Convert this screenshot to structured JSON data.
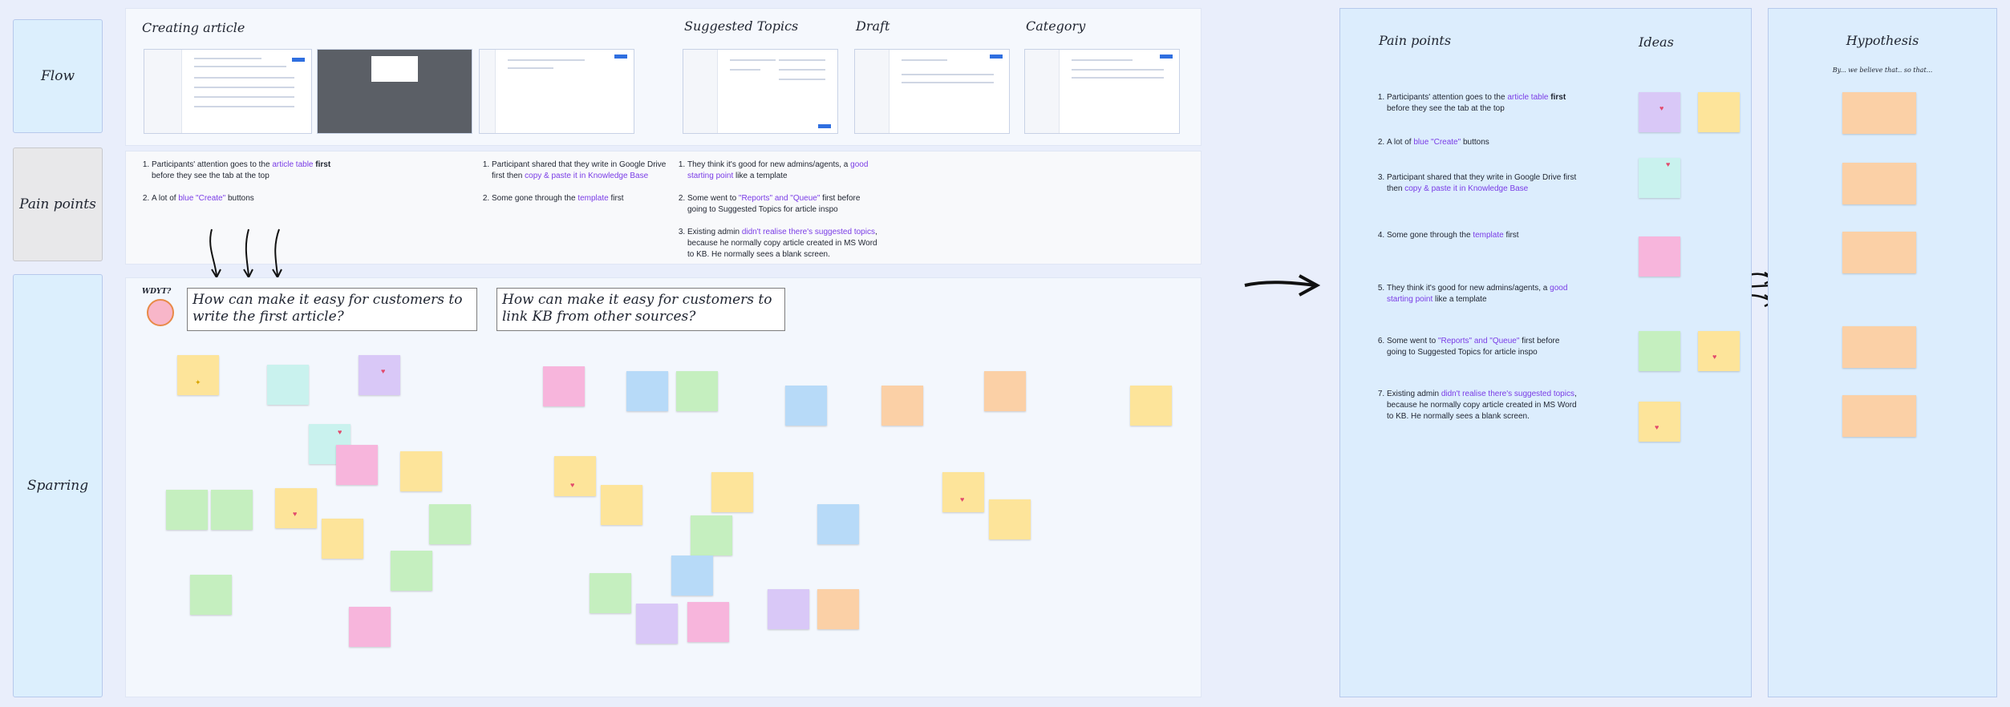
{
  "rows": {
    "flow": "Flow",
    "pain": "Pain points",
    "spar": "Sparring"
  },
  "flow": {
    "creating_article": "Creating article",
    "suggested_topics": "Suggested Topics",
    "draft": "Draft",
    "category": "Category"
  },
  "pain": {
    "col1": [
      {
        "a": "Participants' attention goes to the ",
        "h": "article table",
        "b": " first",
        "c": " before they see the tab at the top"
      },
      {
        "a": "A lot of ",
        "h": "blue \"Create\"",
        "b": " buttons",
        "c": ""
      }
    ],
    "col2": [
      {
        "a": "Participant shared that they write in Google Drive first then ",
        "h": "copy & paste it in Knowledge Base",
        "b": "",
        "c": ""
      },
      {
        "a": "Some gone through the ",
        "h": "template",
        "b": " first",
        "c": ""
      }
    ],
    "col3": [
      {
        "a": "They think it's good for new admins/agents, a ",
        "h": "good starting point",
        "b": " like a template",
        "c": ""
      },
      {
        "a": "Some went to ",
        "h": "\"Reports\" and \"Queue\"",
        "b": " first before going to Suggested Topics for article inspo",
        "c": ""
      },
      {
        "a": "Existing admin ",
        "h": "didn't realise there's suggested topics",
        "b": ", because he normally copy article created in MS Word to KB. He normally sees a blank screen.",
        "c": ""
      }
    ]
  },
  "sparring": {
    "wdyt": "WDYT?",
    "hmw1": "How can make it easy for customers to write the first article?",
    "hmw2": "How can make it easy for customers to link KB from other sources?"
  },
  "right": {
    "pain_title": "Pain points",
    "ideas_title": "Ideas",
    "hyp_title": "Hypothesis",
    "hyp_sub": "By... we believe that.. so that...",
    "items": [
      {
        "a": "Participants' attention goes to the ",
        "h": "article table",
        "b": " first",
        "c": " before they see the tab at the top"
      },
      {
        "a": "A lot of ",
        "h": "blue \"Create\"",
        "b": " buttons",
        "c": ""
      },
      {
        "a": "Participant shared that they write in Google Drive first then ",
        "h": "copy & paste it in Knowledge Base",
        "b": "",
        "c": ""
      },
      {
        "a": "Some gone through the ",
        "h": "template",
        "b": " first",
        "c": ""
      },
      {
        "a": "They think it's good for new admins/agents, a ",
        "h": "good starting point",
        "b": " like a template",
        "c": ""
      },
      {
        "a": "Some went to ",
        "h": "\"Reports\" and \"Queue\"",
        "b": " first before going to Suggested Topics for article inspo",
        "c": ""
      },
      {
        "a": "Existing admin ",
        "h": "didn't realise there's suggested topics",
        "b": ", because he normally copy article created in MS Word to KB. He normally sees a blank screen.",
        "c": ""
      }
    ]
  },
  "colors": {
    "highlight": "#7a3ce6",
    "panel_blue": "#dcedfd",
    "canvas": "#e9eefb"
  },
  "icons": [
    "heart-icon",
    "arrow-right-icon",
    "arrow-down-icon",
    "wdyt-face-icon"
  ]
}
